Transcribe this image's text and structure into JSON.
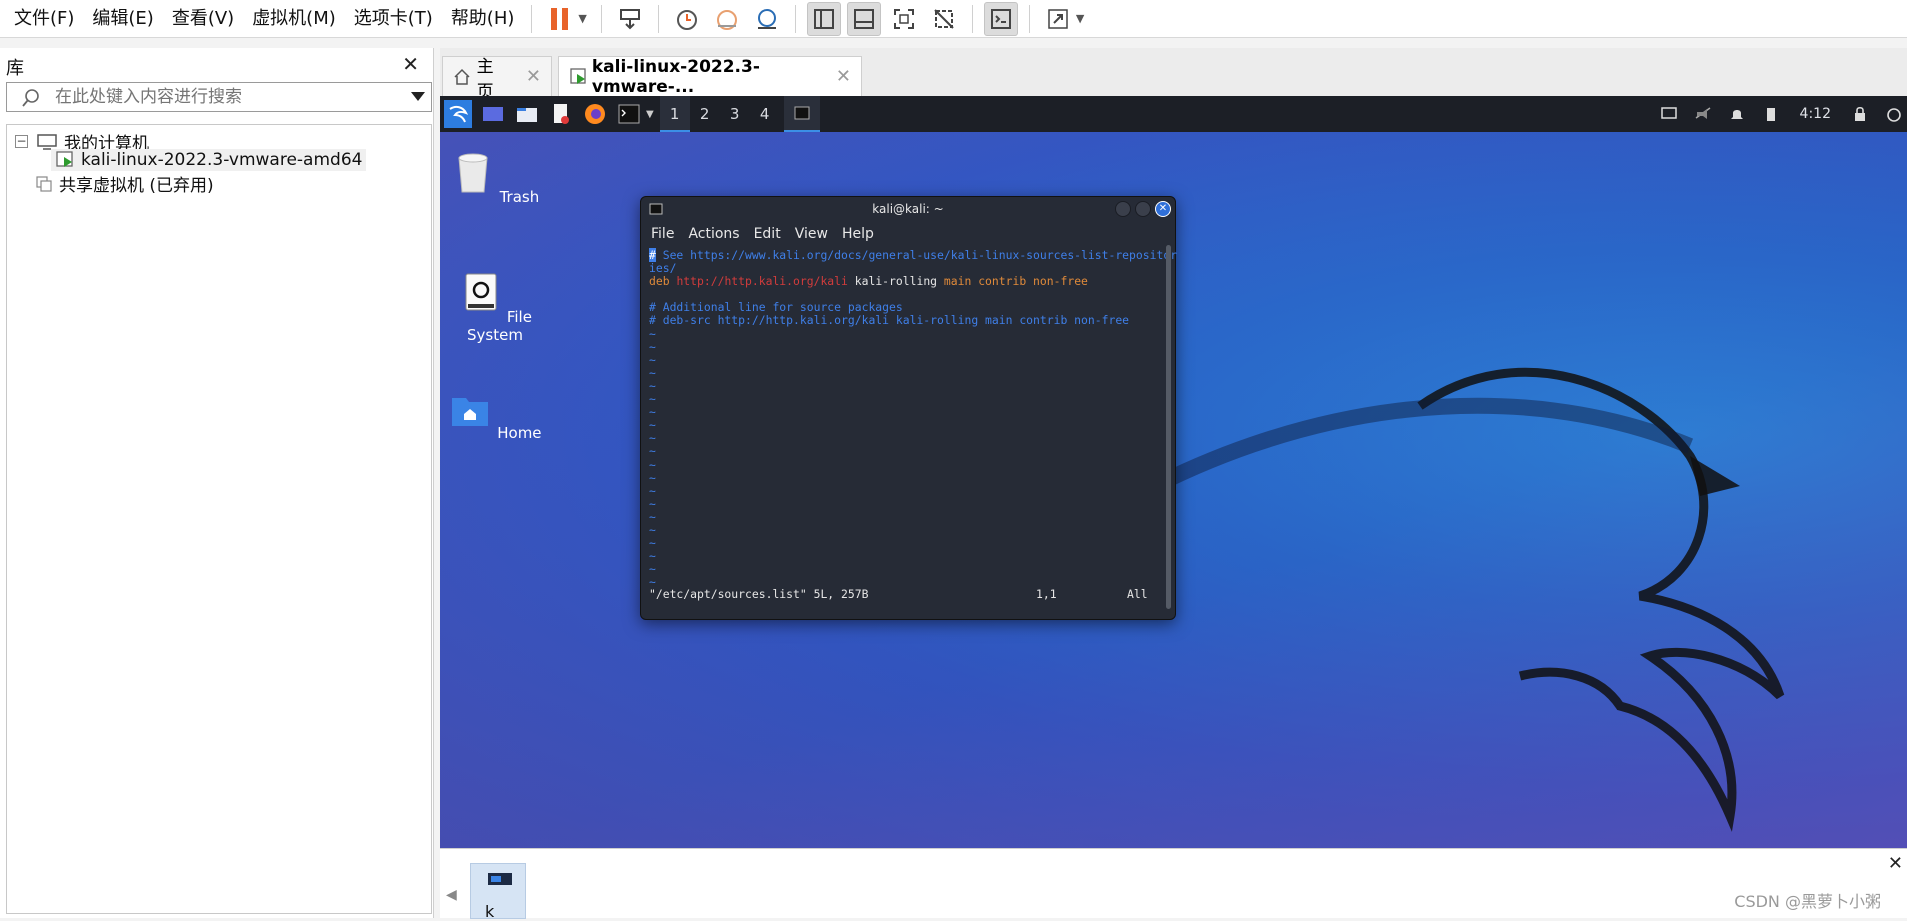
{
  "menubar": {
    "items": [
      "文件(F)",
      "编辑(E)",
      "查看(V)",
      "虚拟机(M)",
      "选项卡(T)",
      "帮助(H)"
    ]
  },
  "library": {
    "title": "库",
    "search_placeholder": "在此处键入内容进行搜索",
    "tree": {
      "my_computer": "我的计算机",
      "vm_name": "kali-linux-2022.3-vmware-amd64",
      "shared": "共享虚拟机 (已弃用)"
    }
  },
  "tabs": {
    "home": "主页",
    "vm": "kali-linux-2022.3-vmware-..."
  },
  "kali_panel": {
    "workspaces": [
      "1",
      "2",
      "3",
      "4"
    ],
    "clock": "4:12"
  },
  "desktop": {
    "trash": "Trash",
    "filesystem": "File System",
    "home": "Home"
  },
  "terminal": {
    "title": "kali@kali: ~",
    "menu": [
      "File",
      "Actions",
      "Edit",
      "View",
      "Help"
    ],
    "line1_cursor": "#",
    "line1": " See https://www.kali.org/docs/general-use/kali-linux-sources-list-repositor",
    "line1b": "ies/",
    "line2_deb": "deb",
    "line2_url": "http://http.kali.org/kali",
    "line2_dist": "kali-rolling",
    "line2_comp": "main contrib non-free",
    "line4": "# Additional line for source packages",
    "line5": "# deb-src http://http.kali.org/kali kali-rolling main contrib non-free",
    "tilde": "~",
    "status_file": "\"/etc/apt/sources.list\" 5L, 257B",
    "status_pos": "1,1",
    "status_all": "All"
  },
  "thumbbar": {
    "label": "k"
  },
  "watermark": "CSDN @黑萝卜小粥",
  "colors": {
    "accent_orange": "#e8632a",
    "kali_blue": "#3f7fe8"
  }
}
